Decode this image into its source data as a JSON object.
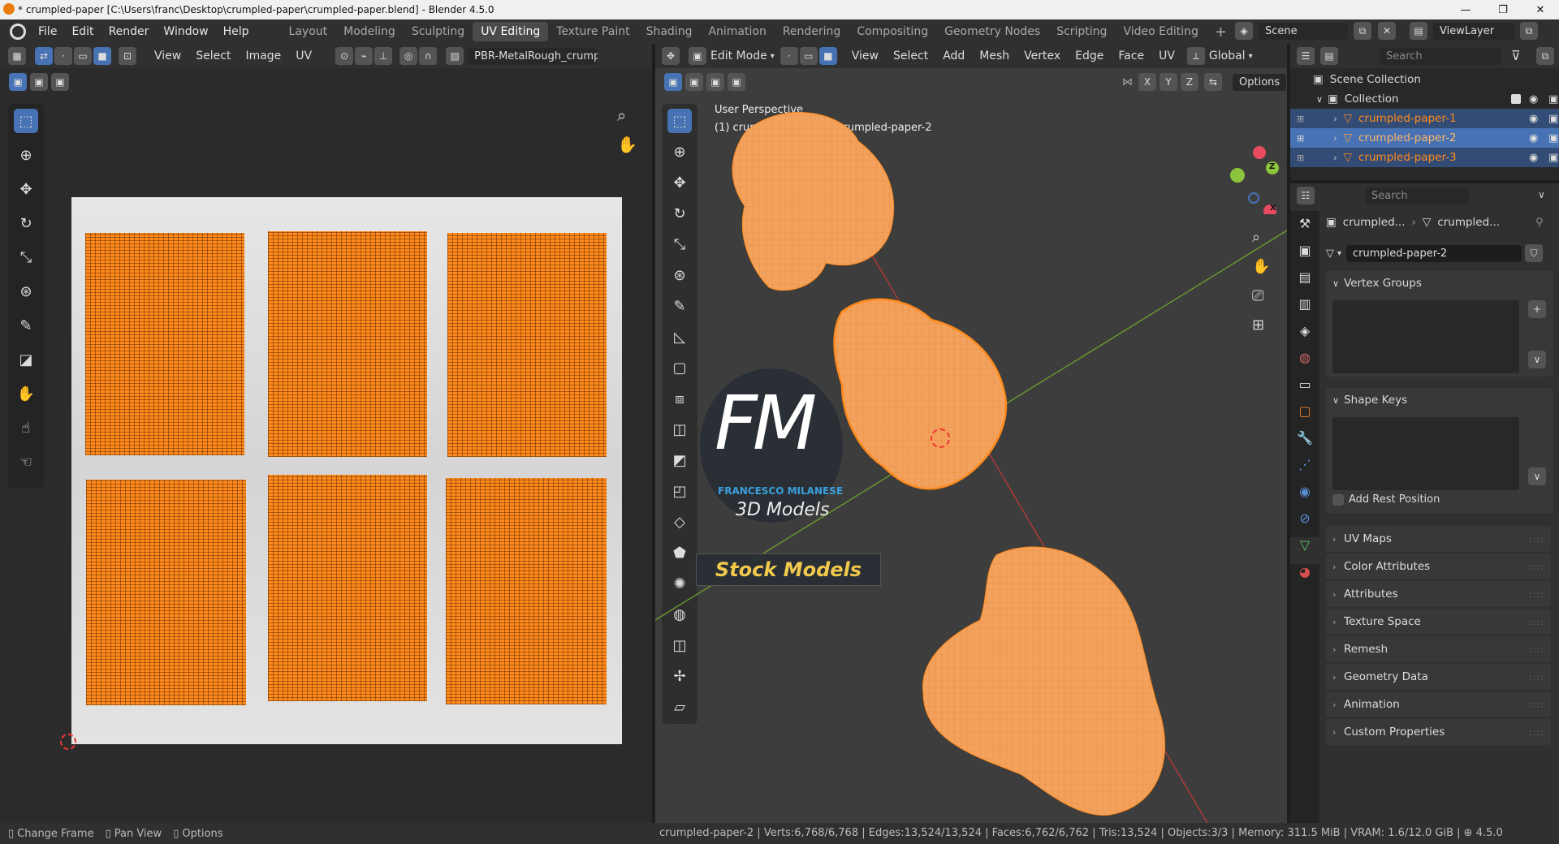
{
  "window": {
    "title": "* crumpled-paper [C:\\Users\\franc\\Desktop\\crumpled-paper\\crumpled-paper.blend] - Blender 4.5.0",
    "controls": [
      "—",
      "❐",
      "✕"
    ]
  },
  "menu": [
    "File",
    "Edit",
    "Render",
    "Window",
    "Help"
  ],
  "workspaces": [
    "Layout",
    "Modeling",
    "Sculpting",
    "UV Editing",
    "Texture Paint",
    "Shading",
    "Animation",
    "Rendering",
    "Compositing",
    "Geometry Nodes",
    "Scripting",
    "Video Editing"
  ],
  "active_workspace": "UV Editing",
  "scene": {
    "name": "Scene",
    "view_layer": "ViewLayer"
  },
  "uv_editor": {
    "menus": [
      "View",
      "Select",
      "Image",
      "UV"
    ],
    "image_name": "PBR-MetalRough_crump"
  },
  "viewport": {
    "mode": "Edit Mode",
    "menus": [
      "View",
      "Select",
      "Add",
      "Mesh",
      "Vertex",
      "Edge",
      "Face",
      "UV"
    ],
    "orientation": "Global",
    "options_label": "Options",
    "axis_toggles": [
      "X",
      "Y",
      "Z"
    ],
    "overlay_title": "User Perspective",
    "overlay_subtitle": "(1) crumpled-paper-2 | crumpled-paper-2",
    "gizmo_labels": [
      "Z",
      "Y",
      "X"
    ]
  },
  "watermark": {
    "logo": "FM",
    "name": "FRANCESCO MILANESE",
    "subtitle": "3D Models",
    "banner": "Stock Models"
  },
  "outliner": {
    "search_placeholder": "Search",
    "scene_collection": "Scene Collection",
    "collection": "Collection",
    "items": [
      "crumpled-paper-1",
      "crumpled-paper-2",
      "crumpled-paper-3"
    ]
  },
  "properties": {
    "search_placeholder": "Search",
    "breadcrumb_obj": "crumpled...",
    "breadcrumb_mesh": "crumpled...",
    "mesh_name": "crumpled-paper-2",
    "vertex_groups": "Vertex Groups",
    "shape_keys": "Shape Keys",
    "add_rest_position": "Add Rest Position",
    "panels": [
      "UV Maps",
      "Color Attributes",
      "Attributes",
      "Texture Space",
      "Remesh",
      "Geometry Data",
      "Animation",
      "Custom Properties"
    ]
  },
  "status": {
    "left": [
      "Change Frame",
      "Pan View",
      "Options"
    ],
    "object": "crumpled-paper-2",
    "verts": "Verts:6,768/6,768",
    "edges": "Edges:13,524/13,524",
    "faces": "Faces:6,762/6,762",
    "tris": "Tris:13,524",
    "objects": "Objects:3/3",
    "memory": "Memory: 311.5 MiB",
    "vram": "VRAM: 1.6/12.0 GiB",
    "version": "4.5.0"
  },
  "colors": {
    "accent": "#4772b3",
    "selection": "#ff8a1c",
    "mesh_orange": "#f3a25e",
    "bg_dark": "#303030",
    "viewport_bg": "#3d3d3d"
  }
}
